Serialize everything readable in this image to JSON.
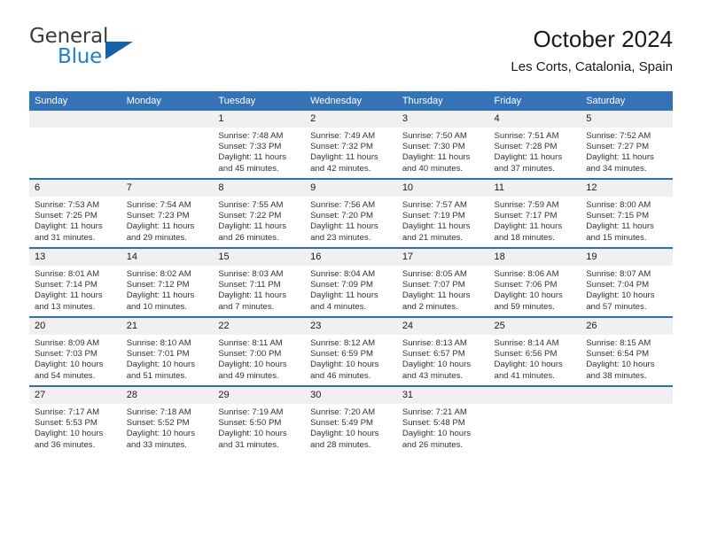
{
  "brand": {
    "name_part1": "General",
    "name_part2": "Blue",
    "triangle_icon": "triangle-icon",
    "color_dark": "#3a3a3a",
    "color_blue": "#1f7fd0",
    "triangle_color": "#1361a8"
  },
  "header": {
    "title": "October 2024",
    "subtitle": "Les Corts, Catalonia, Spain"
  },
  "theme": {
    "header_band": "#3573b9",
    "row_divider": "#2f6fb5",
    "daynum_strip": "#f0f0f0"
  },
  "weekday_headers": [
    "Sunday",
    "Monday",
    "Tuesday",
    "Wednesday",
    "Thursday",
    "Friday",
    "Saturday"
  ],
  "weeks": [
    [
      {
        "day": "",
        "sunrise": "",
        "sunset": "",
        "daylight": ""
      },
      {
        "day": "",
        "sunrise": "",
        "sunset": "",
        "daylight": ""
      },
      {
        "day": "1",
        "sunrise": "Sunrise: 7:48 AM",
        "sunset": "Sunset: 7:33 PM",
        "daylight": "Daylight: 11 hours and 45 minutes."
      },
      {
        "day": "2",
        "sunrise": "Sunrise: 7:49 AM",
        "sunset": "Sunset: 7:32 PM",
        "daylight": "Daylight: 11 hours and 42 minutes."
      },
      {
        "day": "3",
        "sunrise": "Sunrise: 7:50 AM",
        "sunset": "Sunset: 7:30 PM",
        "daylight": "Daylight: 11 hours and 40 minutes."
      },
      {
        "day": "4",
        "sunrise": "Sunrise: 7:51 AM",
        "sunset": "Sunset: 7:28 PM",
        "daylight": "Daylight: 11 hours and 37 minutes."
      },
      {
        "day": "5",
        "sunrise": "Sunrise: 7:52 AM",
        "sunset": "Sunset: 7:27 PM",
        "daylight": "Daylight: 11 hours and 34 minutes."
      }
    ],
    [
      {
        "day": "6",
        "sunrise": "Sunrise: 7:53 AM",
        "sunset": "Sunset: 7:25 PM",
        "daylight": "Daylight: 11 hours and 31 minutes."
      },
      {
        "day": "7",
        "sunrise": "Sunrise: 7:54 AM",
        "sunset": "Sunset: 7:23 PM",
        "daylight": "Daylight: 11 hours and 29 minutes."
      },
      {
        "day": "8",
        "sunrise": "Sunrise: 7:55 AM",
        "sunset": "Sunset: 7:22 PM",
        "daylight": "Daylight: 11 hours and 26 minutes."
      },
      {
        "day": "9",
        "sunrise": "Sunrise: 7:56 AM",
        "sunset": "Sunset: 7:20 PM",
        "daylight": "Daylight: 11 hours and 23 minutes."
      },
      {
        "day": "10",
        "sunrise": "Sunrise: 7:57 AM",
        "sunset": "Sunset: 7:19 PM",
        "daylight": "Daylight: 11 hours and 21 minutes."
      },
      {
        "day": "11",
        "sunrise": "Sunrise: 7:59 AM",
        "sunset": "Sunset: 7:17 PM",
        "daylight": "Daylight: 11 hours and 18 minutes."
      },
      {
        "day": "12",
        "sunrise": "Sunrise: 8:00 AM",
        "sunset": "Sunset: 7:15 PM",
        "daylight": "Daylight: 11 hours and 15 minutes."
      }
    ],
    [
      {
        "day": "13",
        "sunrise": "Sunrise: 8:01 AM",
        "sunset": "Sunset: 7:14 PM",
        "daylight": "Daylight: 11 hours and 13 minutes."
      },
      {
        "day": "14",
        "sunrise": "Sunrise: 8:02 AM",
        "sunset": "Sunset: 7:12 PM",
        "daylight": "Daylight: 11 hours and 10 minutes."
      },
      {
        "day": "15",
        "sunrise": "Sunrise: 8:03 AM",
        "sunset": "Sunset: 7:11 PM",
        "daylight": "Daylight: 11 hours and 7 minutes."
      },
      {
        "day": "16",
        "sunrise": "Sunrise: 8:04 AM",
        "sunset": "Sunset: 7:09 PM",
        "daylight": "Daylight: 11 hours and 4 minutes."
      },
      {
        "day": "17",
        "sunrise": "Sunrise: 8:05 AM",
        "sunset": "Sunset: 7:07 PM",
        "daylight": "Daylight: 11 hours and 2 minutes."
      },
      {
        "day": "18",
        "sunrise": "Sunrise: 8:06 AM",
        "sunset": "Sunset: 7:06 PM",
        "daylight": "Daylight: 10 hours and 59 minutes."
      },
      {
        "day": "19",
        "sunrise": "Sunrise: 8:07 AM",
        "sunset": "Sunset: 7:04 PM",
        "daylight": "Daylight: 10 hours and 57 minutes."
      }
    ],
    [
      {
        "day": "20",
        "sunrise": "Sunrise: 8:09 AM",
        "sunset": "Sunset: 7:03 PM",
        "daylight": "Daylight: 10 hours and 54 minutes."
      },
      {
        "day": "21",
        "sunrise": "Sunrise: 8:10 AM",
        "sunset": "Sunset: 7:01 PM",
        "daylight": "Daylight: 10 hours and 51 minutes."
      },
      {
        "day": "22",
        "sunrise": "Sunrise: 8:11 AM",
        "sunset": "Sunset: 7:00 PM",
        "daylight": "Daylight: 10 hours and 49 minutes."
      },
      {
        "day": "23",
        "sunrise": "Sunrise: 8:12 AM",
        "sunset": "Sunset: 6:59 PM",
        "daylight": "Daylight: 10 hours and 46 minutes."
      },
      {
        "day": "24",
        "sunrise": "Sunrise: 8:13 AM",
        "sunset": "Sunset: 6:57 PM",
        "daylight": "Daylight: 10 hours and 43 minutes."
      },
      {
        "day": "25",
        "sunrise": "Sunrise: 8:14 AM",
        "sunset": "Sunset: 6:56 PM",
        "daylight": "Daylight: 10 hours and 41 minutes."
      },
      {
        "day": "26",
        "sunrise": "Sunrise: 8:15 AM",
        "sunset": "Sunset: 6:54 PM",
        "daylight": "Daylight: 10 hours and 38 minutes."
      }
    ],
    [
      {
        "day": "27",
        "sunrise": "Sunrise: 7:17 AM",
        "sunset": "Sunset: 5:53 PM",
        "daylight": "Daylight: 10 hours and 36 minutes."
      },
      {
        "day": "28",
        "sunrise": "Sunrise: 7:18 AM",
        "sunset": "Sunset: 5:52 PM",
        "daylight": "Daylight: 10 hours and 33 minutes."
      },
      {
        "day": "29",
        "sunrise": "Sunrise: 7:19 AM",
        "sunset": "Sunset: 5:50 PM",
        "daylight": "Daylight: 10 hours and 31 minutes."
      },
      {
        "day": "30",
        "sunrise": "Sunrise: 7:20 AM",
        "sunset": "Sunset: 5:49 PM",
        "daylight": "Daylight: 10 hours and 28 minutes."
      },
      {
        "day": "31",
        "sunrise": "Sunrise: 7:21 AM",
        "sunset": "Sunset: 5:48 PM",
        "daylight": "Daylight: 10 hours and 26 minutes."
      },
      {
        "day": "",
        "sunrise": "",
        "sunset": "",
        "daylight": ""
      },
      {
        "day": "",
        "sunrise": "",
        "sunset": "",
        "daylight": ""
      }
    ]
  ]
}
